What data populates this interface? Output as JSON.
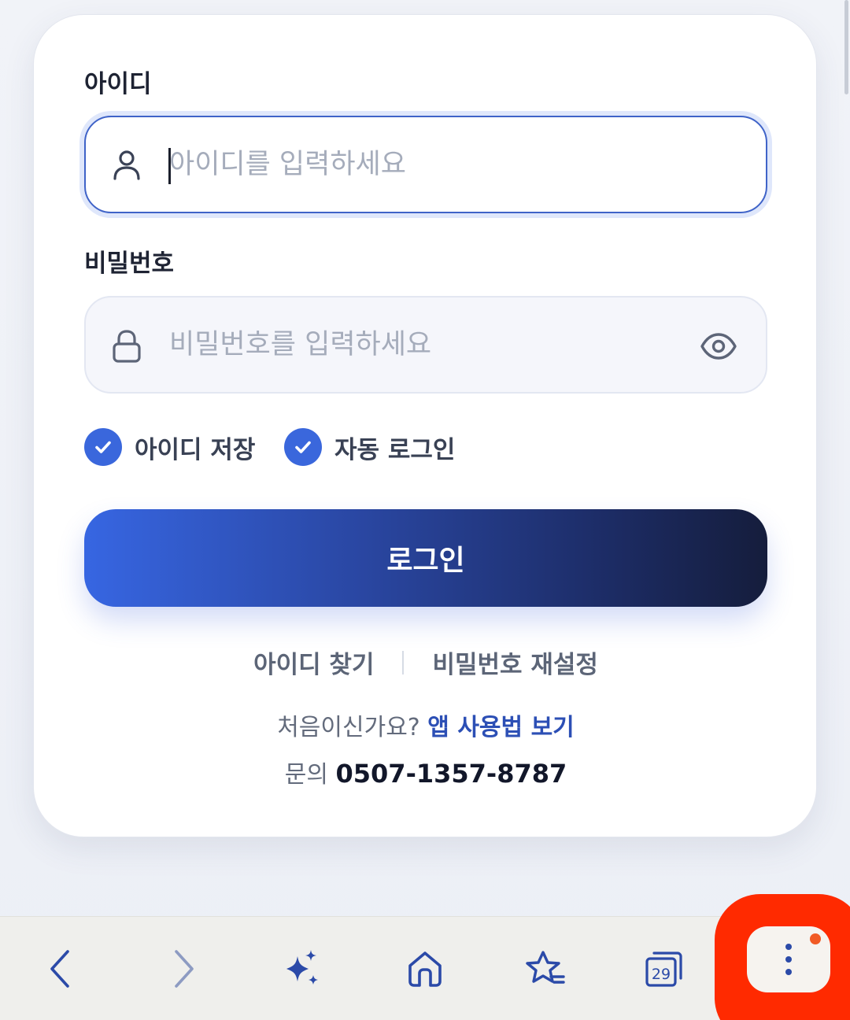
{
  "login_form": {
    "id_label": "아이디",
    "id_placeholder": "아이디를 입력하세요",
    "id_value": "",
    "password_label": "비밀번호",
    "password_placeholder": "비밀번호를 입력하세요",
    "password_value": "",
    "save_id_label": "아이디 저장",
    "save_id_checked": true,
    "auto_login_label": "자동 로그인",
    "auto_login_checked": true,
    "login_button_label": "로그인",
    "find_id_label": "아이디 찾기",
    "reset_password_label": "비밀번호 재설정",
    "first_time_text": "처음이신가요?",
    "app_guide_label": "앱 사용법 보기",
    "contact_label": "문의",
    "contact_phone": "0507-1357-8787"
  },
  "browser_toolbar": {
    "buttons": [
      {
        "name": "back",
        "icon": "chevron-left-icon"
      },
      {
        "name": "forward",
        "icon": "chevron-right-icon"
      },
      {
        "name": "ai-assistant",
        "icon": "sparkle-icon"
      },
      {
        "name": "home",
        "icon": "home-icon"
      },
      {
        "name": "bookmarks",
        "icon": "star-list-icon"
      },
      {
        "name": "tabs",
        "icon": "tabs-icon"
      },
      {
        "name": "menu",
        "icon": "more-vertical-icon"
      }
    ],
    "tab_count": "29",
    "menu_has_notification": true,
    "accent_color": "#2b4aa8",
    "highlight_color": "#ff2a00"
  },
  "colors": {
    "brand_primary": "#3a67dc",
    "brand_dark": "#151d3c",
    "link_color": "#2c4fb5"
  }
}
